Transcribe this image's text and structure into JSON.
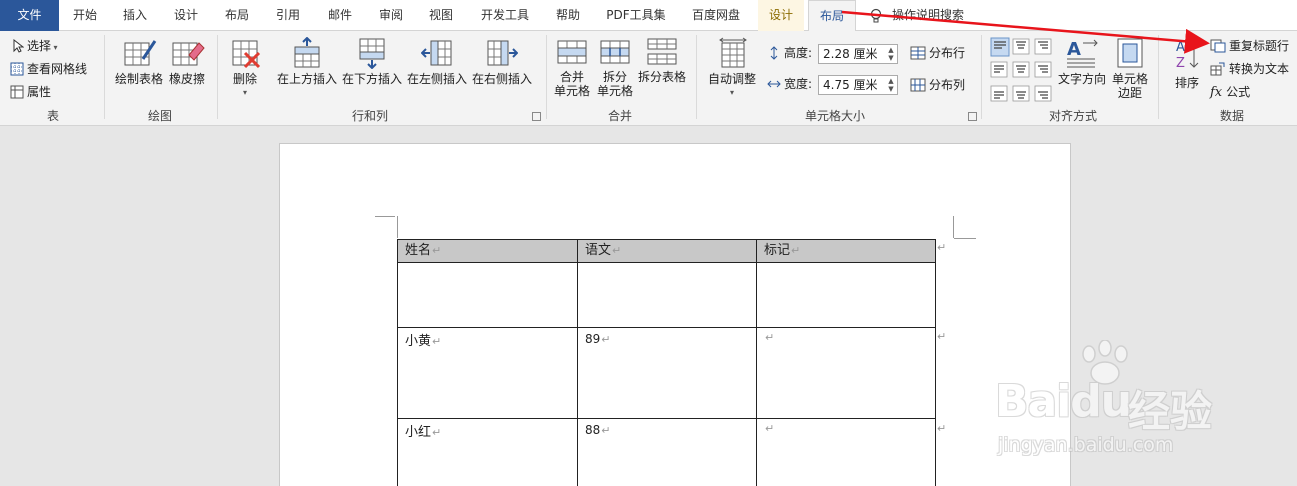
{
  "tabs": [
    {
      "label": "文件",
      "kind": "file"
    },
    {
      "label": "开始"
    },
    {
      "label": "插入"
    },
    {
      "label": "设计"
    },
    {
      "label": "布局"
    },
    {
      "label": "引用"
    },
    {
      "label": "邮件"
    },
    {
      "label": "审阅"
    },
    {
      "label": "视图"
    },
    {
      "label": "开发工具"
    },
    {
      "label": "帮助"
    },
    {
      "label": "PDF工具集"
    },
    {
      "label": "百度网盘"
    },
    {
      "label": "设计",
      "kind": "contextual"
    },
    {
      "label": "布局",
      "kind": "active"
    }
  ],
  "tell_me": "操作说明搜索",
  "groups": {
    "table": {
      "label": "表",
      "select": "选择",
      "gridlines": "查看网格线",
      "properties": "属性"
    },
    "draw": {
      "label": "绘图",
      "draw_table": "绘制表格",
      "eraser": "橡皮擦"
    },
    "rows_cols": {
      "label": "行和列",
      "delete": "删除",
      "insert_above": "在上方插入",
      "insert_below": "在下方插入",
      "insert_left": "在左侧插入",
      "insert_right": "在右侧插入"
    },
    "merge": {
      "label": "合并",
      "merge_cells_1": "合并",
      "merge_cells_2": "单元格",
      "split_cells_1": "拆分",
      "split_cells_2": "单元格",
      "split_table": "拆分表格"
    },
    "cell_size": {
      "label": "单元格大小",
      "autofit": "自动调整",
      "height_label": "高度:",
      "height_value": "2.28 厘米",
      "width_label": "宽度:",
      "width_value": "4.75 厘米",
      "distribute_rows": "分布行",
      "distribute_cols": "分布列"
    },
    "alignment": {
      "label": "对齐方式",
      "text_direction": "文字方向",
      "cell_margins_1": "单元格",
      "cell_margins_2": "边距"
    },
    "data": {
      "label": "数据",
      "sort": "排序",
      "repeat_header": "重复标题行",
      "convert_text": "转换为文本",
      "formula": "公式"
    }
  },
  "table": {
    "headers": [
      "姓名",
      "语文",
      "标记"
    ],
    "rows": [
      [
        "小黄",
        "89",
        ""
      ],
      [
        "小红",
        "88",
        ""
      ]
    ]
  },
  "watermark": {
    "brand": "Baidu",
    "cn": "经验",
    "url": "jingyan.baidu.com"
  },
  "colors": {
    "accent": "#2b579a",
    "arrow": "#e8141b"
  }
}
